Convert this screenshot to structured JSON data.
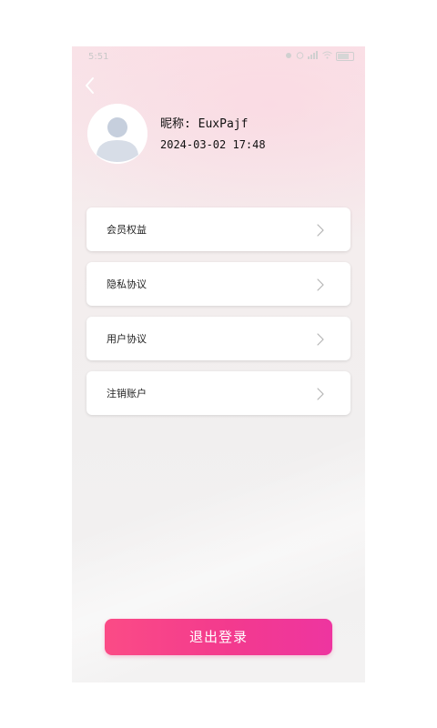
{
  "status_bar": {
    "time": "5:51",
    "icons": [
      "notification-icon",
      "alarm-icon",
      "signal-icon",
      "wifi-icon",
      "battery-icon"
    ]
  },
  "header": {
    "back_icon": "chevron-left-icon"
  },
  "profile": {
    "avatar_icon": "default-user-avatar-icon",
    "nickname_label": "昵称:",
    "nickname_value": "EuxPajf",
    "timestamp": "2024-03-02 17:48"
  },
  "menu": {
    "items": [
      {
        "label": "会员权益",
        "icon": "chevron-right-icon"
      },
      {
        "label": "隐私协议",
        "icon": "chevron-right-icon"
      },
      {
        "label": "用户协议",
        "icon": "chevron-right-icon"
      },
      {
        "label": "注销账户",
        "icon": "chevron-right-icon"
      }
    ]
  },
  "logout": {
    "label": "退出登录"
  },
  "colors": {
    "accent_start": "#fb4b86",
    "accent_end": "#ee35a0",
    "card_bg": "#ffffff",
    "page_bg_top": "#f9e3e8",
    "page_bg_bottom": "#f3f2f2"
  }
}
